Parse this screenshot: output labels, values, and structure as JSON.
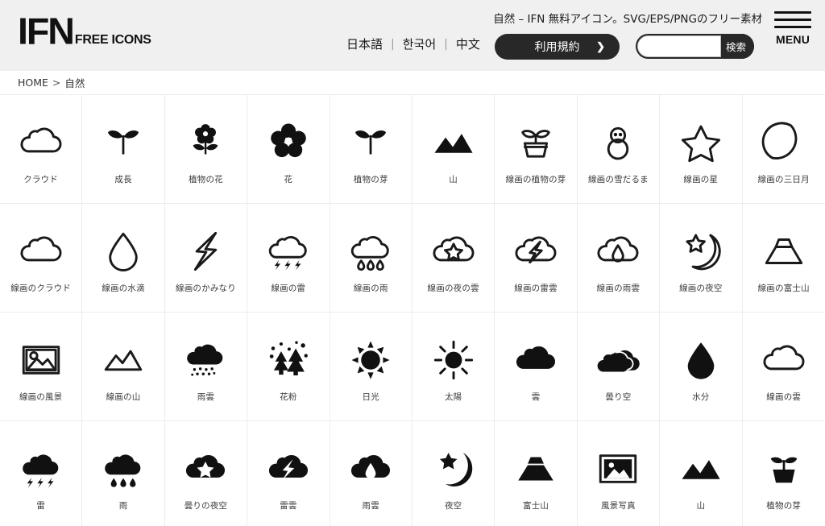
{
  "header": {
    "logo_main": "IFN",
    "logo_sub": "FREE ICONS",
    "tagline": "自然 – IFN 無料アイコン。SVG/EPS/PNGのフリー素材",
    "languages": [
      "日本語",
      "한국어",
      "中文"
    ],
    "lang_separator": "|",
    "terms_label": "利用規約",
    "terms_arrow": "❯",
    "search_value": "",
    "search_placeholder": "",
    "search_button_label": "検索",
    "menu_label": "MENU"
  },
  "breadcrumb": {
    "home": "HOME",
    "separator": ">",
    "current": "自然"
  },
  "grid": {
    "columns": 10,
    "items": [
      {
        "label": "クラウド",
        "icon": "cloud-outline"
      },
      {
        "label": "成長",
        "icon": "sprout-solid"
      },
      {
        "label": "植物の花",
        "icon": "plant-flower-solid"
      },
      {
        "label": "花",
        "icon": "flower-solid"
      },
      {
        "label": "植物の芽",
        "icon": "sprout-solid"
      },
      {
        "label": "山",
        "icon": "mountain-solid"
      },
      {
        "label": "線画の植物の芽",
        "icon": "potted-sprout-outline"
      },
      {
        "label": "線画の雪だるま",
        "icon": "snowman-outline"
      },
      {
        "label": "線画の星",
        "icon": "star-outline"
      },
      {
        "label": "線画の三日月",
        "icon": "crescent-moon-outline"
      },
      {
        "label": "線画のクラウド",
        "icon": "cloud-outline"
      },
      {
        "label": "線画の水滴",
        "icon": "droplet-outline"
      },
      {
        "label": "線画のかみなり",
        "icon": "bolt-outline"
      },
      {
        "label": "線画の雷",
        "icon": "cloud-thunder-outline"
      },
      {
        "label": "線画の雨",
        "icon": "cloud-rain-outline"
      },
      {
        "label": "線画の夜の雲",
        "icon": "cloud-star-outline"
      },
      {
        "label": "線画の雷雲",
        "icon": "cloud-bolt-outline"
      },
      {
        "label": "線画の雨雲",
        "icon": "cloud-drop-outline"
      },
      {
        "label": "線画の夜空",
        "icon": "moon-star-outline"
      },
      {
        "label": "線画の富士山",
        "icon": "fuji-outline"
      },
      {
        "label": "線画の風景",
        "icon": "landscape-photo-outline"
      },
      {
        "label": "線画の山",
        "icon": "mountain-outline"
      },
      {
        "label": "雨雲",
        "icon": "cloud-drizzle-solid"
      },
      {
        "label": "花粉",
        "icon": "pollen-trees-solid"
      },
      {
        "label": "日光",
        "icon": "sunlight-solid"
      },
      {
        "label": "太陽",
        "icon": "sun-solid"
      },
      {
        "label": "雲",
        "icon": "cloud-solid"
      },
      {
        "label": "曇り空",
        "icon": "clouds-overcast-solid"
      },
      {
        "label": "水分",
        "icon": "droplet-solid"
      },
      {
        "label": "線画の雲",
        "icon": "cloud-outline"
      },
      {
        "label": "雷",
        "icon": "cloud-thunder-solid"
      },
      {
        "label": "雨",
        "icon": "cloud-rain-solid"
      },
      {
        "label": "曇りの夜空",
        "icon": "cloud-star-solid"
      },
      {
        "label": "雷雲",
        "icon": "cloud-bolt-solid"
      },
      {
        "label": "雨雲",
        "icon": "cloud-drop-solid"
      },
      {
        "label": "夜空",
        "icon": "moon-star-solid"
      },
      {
        "label": "富士山",
        "icon": "fuji-solid"
      },
      {
        "label": "風景写真",
        "icon": "landscape-photo-solid"
      },
      {
        "label": "山",
        "icon": "mountain-solid"
      },
      {
        "label": "植物の芽",
        "icon": "potted-sprout-solid"
      }
    ]
  },
  "colors": {
    "header_bg": "#f0f0f0",
    "page_bg": "#ffffff",
    "ink": "#111111",
    "grid_line": "#ececec",
    "label": "#3a3a3a",
    "dark_pill": "#282828"
  }
}
